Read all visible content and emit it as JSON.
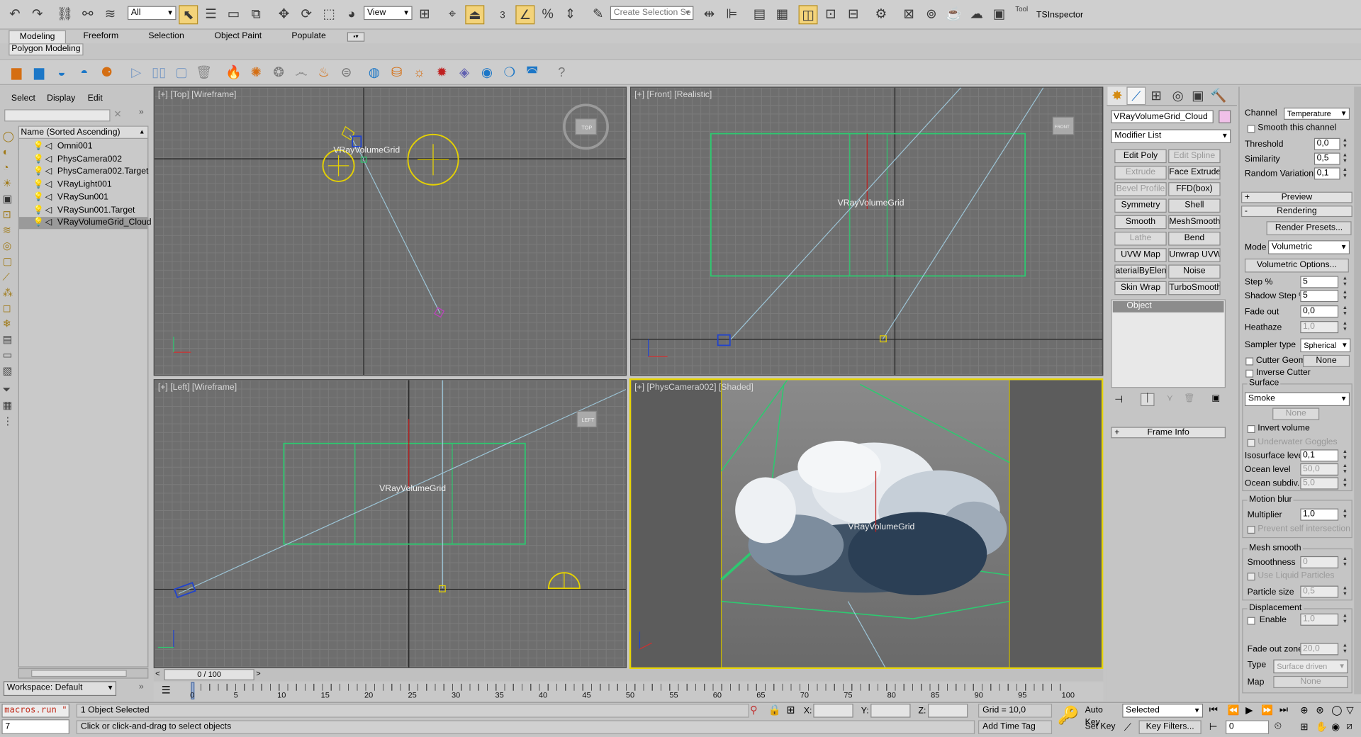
{
  "toolbar": {
    "selection_filter": "All",
    "reference_coord": "View",
    "named_selection_placeholder": "Create Selection Se",
    "tsinspector": "TSInspector",
    "snap_angle": "3"
  },
  "ribbon": {
    "tabs": [
      "Modeling",
      "Freeform",
      "Selection",
      "Object Paint",
      "Populate"
    ],
    "active_tab": "Modeling",
    "subtab": "Polygon Modeling"
  },
  "scene_explorer": {
    "menu": [
      "Select",
      "Display",
      "Edit"
    ],
    "header": "Name (Sorted Ascending)",
    "items": [
      "Omni001",
      "PhysCamera002",
      "PhysCamera002.Target",
      "VRayLight001",
      "VRaySun001",
      "VRaySun001.Target",
      "VRayVolumeGrid_Cloud"
    ],
    "selected": "VRayVolumeGrid_Cloud",
    "workspace": "Workspace: Default"
  },
  "viewports": {
    "top": "[+] [Top] [Wireframe]",
    "front": "[+] [Front] [Realistic]",
    "left": "[+] [Left] [Wireframe]",
    "camera": "[+] [PhysCamera002] [Shaded]",
    "object_label": "VRayVolumeGrid",
    "cube_top": "TOP",
    "cube_front": "FRONT",
    "cube_left": "LEFT"
  },
  "command_panel": {
    "object_name": "VRayVolumeGrid_Cloud",
    "modifier_list": "Modifier List",
    "modifiers": [
      {
        "label": "Edit Poly",
        "enabled": true
      },
      {
        "label": "Edit Spline",
        "enabled": false
      },
      {
        "label": "Extrude",
        "enabled": false
      },
      {
        "label": "Face Extrude",
        "enabled": true
      },
      {
        "label": "Bevel Profile",
        "enabled": false
      },
      {
        "label": "FFD(box)",
        "enabled": true
      },
      {
        "label": "Symmetry",
        "enabled": true
      },
      {
        "label": "Shell",
        "enabled": true
      },
      {
        "label": "Smooth",
        "enabled": true
      },
      {
        "label": "MeshSmooth",
        "enabled": true
      },
      {
        "label": "Lathe",
        "enabled": false
      },
      {
        "label": "Bend",
        "enabled": true
      },
      {
        "label": "UVW Map",
        "enabled": true
      },
      {
        "label": "Unwrap UVW",
        "enabled": true
      },
      {
        "label": "aterialByEleme",
        "enabled": true
      },
      {
        "label": "Noise",
        "enabled": true
      },
      {
        "label": "Skin Wrap",
        "enabled": true
      },
      {
        "label": "TurboSmooth",
        "enabled": true
      }
    ],
    "stack_item": "Object",
    "frame_info": "Frame Info"
  },
  "params": {
    "channel_label": "Channel",
    "channel_value": "Temperature",
    "smooth_channel": "Smooth this channel",
    "threshold_label": "Threshold",
    "threshold": "0,0",
    "similarity_label": "Similarity",
    "similarity": "0,5",
    "random_label": "Random Variation",
    "random": "0,1",
    "preview": "Preview",
    "rendering": "Rendering",
    "render_presets": "Render Presets...",
    "mode_label": "Mode",
    "mode": "Volumetric",
    "volumetric_options": "Volumetric Options...",
    "step_label": "Step %",
    "step": "5",
    "shadow_step_label": "Shadow Step %",
    "shadow_step": "5",
    "fade_out_label": "Fade out",
    "fade_out": "0,0",
    "heathaze_label": "Heathaze",
    "heathaze": "1,0",
    "sampler_label": "Sampler type",
    "sampler": "Spherical",
    "cutter_geom": "Cutter Geom",
    "cutter_none": "None",
    "inverse_cutter": "Inverse Cutter",
    "surface": "Surface",
    "surface_value": "Smoke",
    "surface_none": "None",
    "invert_volume": "Invert volume",
    "underwater": "Underwater Goggles",
    "isosurface_label": "Isosurface level",
    "isosurface": "0,1",
    "ocean_level_label": "Ocean level",
    "ocean_level": "50,0",
    "ocean_subdiv_label": "Ocean subdiv.",
    "ocean_subdiv": "5,0",
    "motion_blur": "Motion blur",
    "multiplier_label": "Multiplier",
    "multiplier": "1,0",
    "prevent_self": "Prevent self intersection",
    "mesh_smooth": "Mesh smooth",
    "smoothness_label": "Smoothness",
    "smoothness": "0",
    "liquid": "Use Liquid Particles",
    "particle_size_label": "Particle size",
    "particle_size": "0,5",
    "displacement": "Displacement",
    "enable": "Enable",
    "enable_value": "1,0",
    "fade_zone_label": "Fade out zone",
    "fade_zone": "20,0",
    "type_label": "Type",
    "type_value": "Surface driven",
    "map_label": "Map",
    "map_value": "None"
  },
  "timeline": {
    "frame": "0 / 100",
    "ticks": [
      "0",
      "5",
      "10",
      "15",
      "20",
      "25",
      "30",
      "35",
      "40",
      "45",
      "50",
      "55",
      "60",
      "65",
      "70",
      "75",
      "80",
      "85",
      "90",
      "95",
      "100"
    ]
  },
  "status": {
    "script": "macros.run \"",
    "script_line": "7",
    "selected": "1 Object Selected",
    "prompt": "Click or click-and-drag to select objects",
    "x_label": "X:",
    "y_label": "Y:",
    "z_label": "Z:",
    "grid": "Grid = 10,0",
    "add_time_tag": "Add Time Tag",
    "auto_key": "Auto Key",
    "set_key": "Set Key",
    "key_mode": "Selected",
    "key_filters": "Key Filters...",
    "current_frame": "0"
  }
}
